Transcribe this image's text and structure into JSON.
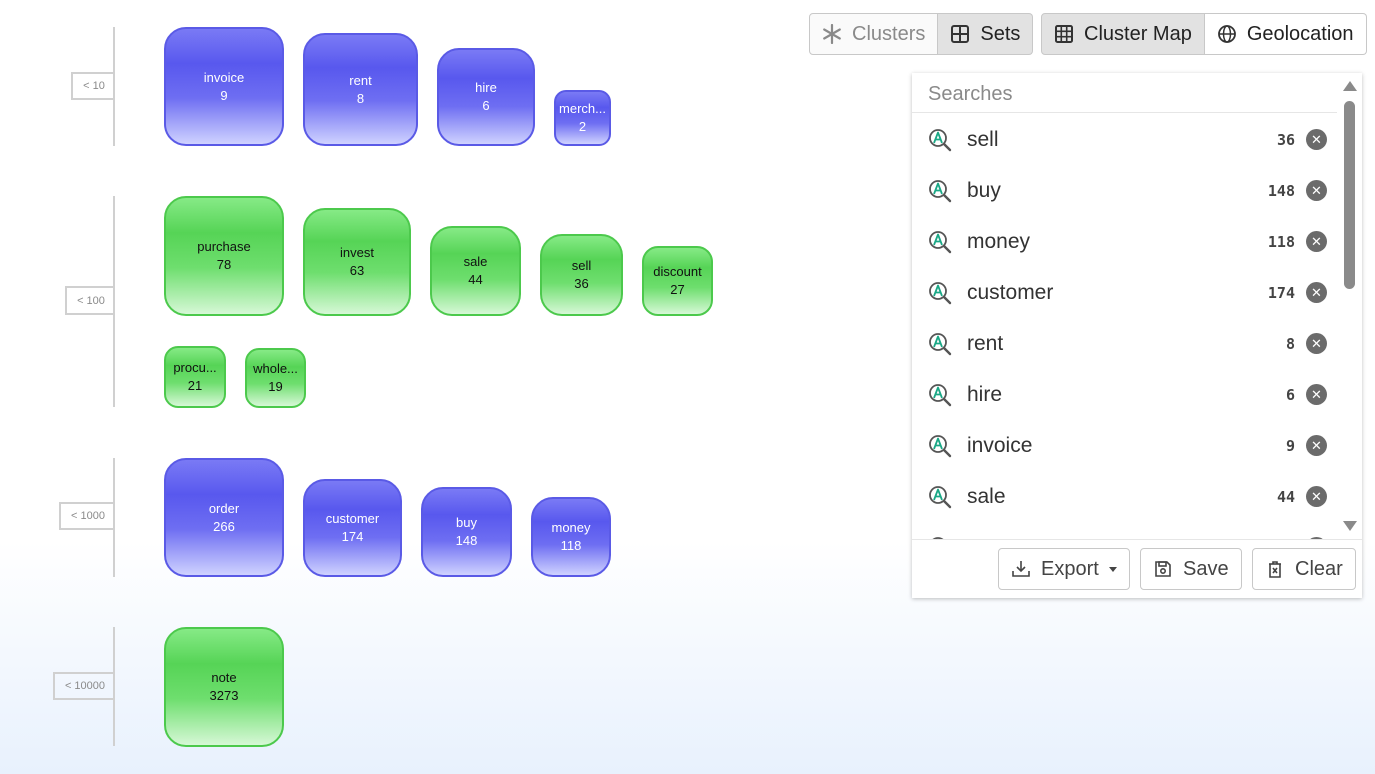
{
  "toolbar": {
    "view_tabs": [
      {
        "label": "Clusters",
        "icon": "asterisk-icon"
      },
      {
        "label": "Sets",
        "icon": "grid-icon"
      }
    ],
    "map_tabs": [
      {
        "label": "Cluster Map",
        "icon": "table-icon"
      },
      {
        "label": "Geolocation",
        "icon": "globe-icon"
      }
    ]
  },
  "groups": [
    {
      "range_label": "< 10",
      "color": "blue",
      "items": [
        {
          "label": "invoice",
          "count": "9"
        },
        {
          "label": "rent",
          "count": "8"
        },
        {
          "label": "hire",
          "count": "6"
        },
        {
          "label": "merch...",
          "count": "2"
        }
      ]
    },
    {
      "range_label": "< 100",
      "color": "green",
      "items": [
        {
          "label": "purchase",
          "count": "78"
        },
        {
          "label": "invest",
          "count": "63"
        },
        {
          "label": "sale",
          "count": "44"
        },
        {
          "label": "sell",
          "count": "36"
        },
        {
          "label": "discount",
          "count": "27"
        },
        {
          "label": "procu...",
          "count": "21"
        },
        {
          "label": "whole...",
          "count": "19"
        }
      ]
    },
    {
      "range_label": "< 1000",
      "color": "blue",
      "items": [
        {
          "label": "order",
          "count": "266"
        },
        {
          "label": "customer",
          "count": "174"
        },
        {
          "label": "buy",
          "count": "148"
        },
        {
          "label": "money",
          "count": "118"
        }
      ]
    },
    {
      "range_label": "< 10000",
      "color": "green",
      "items": [
        {
          "label": "note",
          "count": "3273"
        }
      ]
    }
  ],
  "searches": {
    "header": "Searches",
    "items": [
      {
        "term": "sell",
        "count": "36"
      },
      {
        "term": "buy",
        "count": "148"
      },
      {
        "term": "money",
        "count": "118"
      },
      {
        "term": "customer",
        "count": "174"
      },
      {
        "term": "rent",
        "count": "8"
      },
      {
        "term": "hire",
        "count": "6"
      },
      {
        "term": "invoice",
        "count": "9"
      },
      {
        "term": "sale",
        "count": "44"
      }
    ],
    "export_label": "Export",
    "save_label": "Save",
    "clear_label": "Clear"
  },
  "colors": {
    "blue": "#5858ee",
    "green": "#4cc94c"
  }
}
